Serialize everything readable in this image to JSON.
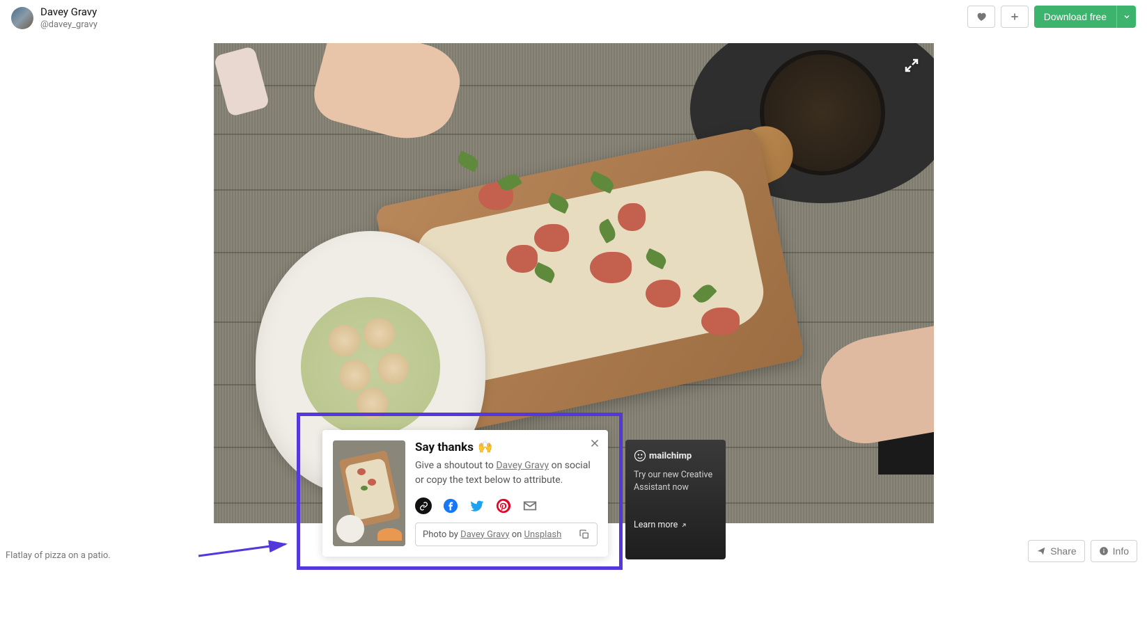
{
  "header": {
    "author_name": "Davey Gravy",
    "author_handle": "@davey_gravy",
    "download_label": "Download free"
  },
  "caption": "Flatlay of pizza on a patio.",
  "thanks": {
    "title": "Say thanks",
    "emoji": "🙌",
    "subtitle_pre": "Give a shoutout to ",
    "subtitle_link": "Davey Gravy",
    "subtitle_post": " on social or copy the text below to attribute.",
    "attribution_pre": "Photo by ",
    "attribution_author": "Davey Gravy",
    "attribution_mid": " on ",
    "attribution_site": "Unsplash"
  },
  "promo": {
    "brand": "mailchimp",
    "text": "Try our new Creative Assistant now",
    "cta": "Learn more"
  },
  "bottom": {
    "share_label": "Share",
    "info_label": "Info"
  }
}
